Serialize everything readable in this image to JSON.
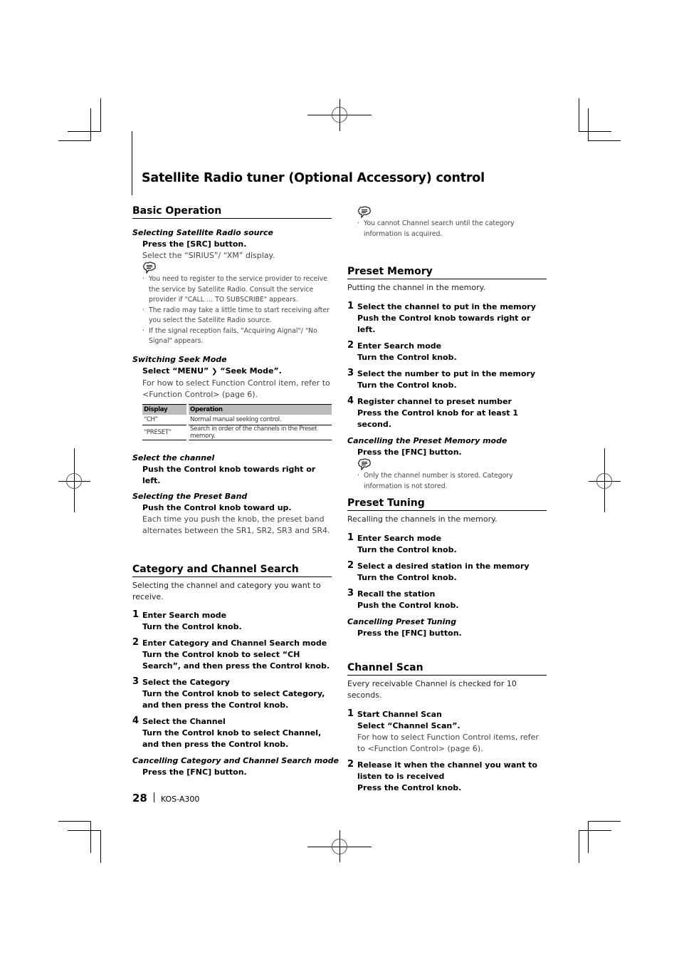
{
  "page": {
    "title": "Satellite Radio tuner (Optional Accessory) control",
    "page_number": "28",
    "model": "KOS-A300"
  },
  "basic_operation": {
    "heading": "Basic Operation",
    "source": {
      "subhead": "Selecting Satellite Radio source",
      "action": "Press the [SRC] button.",
      "detail": "Select the “SIRIUS”/ “XM” display.",
      "note_icon": "note-icon",
      "notes": [
        "You need to register to the service provider to receive the service by Satellite Radio. Consult the service provider if \"CALL … TO SUBSCRIBE\" appears.",
        "The radio may take a little time to start receiving after you select the Satellite Radio source.",
        "If the signal reception fails, \"Acquiring Aignal\"/ \"No Signal\" appears."
      ]
    },
    "seek_mode": {
      "subhead": "Switching Seek Mode",
      "action_pre": "Select “MENU”",
      "action_arrow": "❯",
      "action_post": "“Seek Mode”.",
      "detail": "For how to select Function Control item, refer to <Function Control> (page 6).",
      "table": {
        "headers": [
          "Display",
          "Operation"
        ],
        "rows": [
          [
            "“CH”",
            "Normal manual seeking control."
          ],
          [
            "“PRESET”",
            "Search in order of the channels in the Preset memory."
          ]
        ]
      }
    },
    "select_channel": {
      "subhead": "Select the channel",
      "action": "Push the Control knob towards right or left."
    },
    "preset_band": {
      "subhead": "Selecting the Preset Band",
      "action": "Push the Control knob toward up.",
      "detail": "Each time you push the knob, the preset band alternates between the SR1, SR2, SR3 and SR4."
    }
  },
  "category_search": {
    "heading": "Category and Channel Search",
    "intro": "Selecting the channel and category you want to receive.",
    "steps": [
      {
        "num": "1",
        "title": "Enter Search mode",
        "action": "Turn the Control knob."
      },
      {
        "num": "2",
        "title": "Enter Category and Channel Search mode",
        "action": "Turn the Control knob to select “CH Search”, and then press the Control knob."
      },
      {
        "num": "3",
        "title": "Select the Category",
        "action": "Turn the Control knob to select Category, and then press the Control knob."
      },
      {
        "num": "4",
        "title": "Select the Channel",
        "action": "Turn the Control knob to select Channel, and then press the Control knob."
      }
    ],
    "cancel": {
      "subhead": "Cancelling Category and Channel Search mode",
      "action": "Press the [FNC] button."
    },
    "notes": [
      "You cannot Channel search until the category information is acquired."
    ]
  },
  "preset_memory": {
    "heading": "Preset Memory",
    "intro": "Putting the channel in the memory.",
    "steps": [
      {
        "num": "1",
        "title": "Select the channel to put in the memory",
        "action": "Push the Control knob towards right or left."
      },
      {
        "num": "2",
        "title": "Enter Search mode",
        "action": "Turn the Control knob."
      },
      {
        "num": "3",
        "title": "Select the number to put in the memory",
        "action": "Turn the Control knob."
      },
      {
        "num": "4",
        "title": "Register channel to preset number",
        "action": "Press the Control knob for at least 1 second."
      }
    ],
    "cancel": {
      "subhead": "Cancelling the Preset Memory mode",
      "action": "Press the [FNC] button."
    },
    "notes": [
      "Only the channel number is stored. Category information is not stored."
    ]
  },
  "preset_tuning": {
    "heading": "Preset Tuning",
    "intro": "Recalling the channels in the memory.",
    "steps": [
      {
        "num": "1",
        "title": "Enter Search mode",
        "action": "Turn the Control knob."
      },
      {
        "num": "2",
        "title": "Select a desired station in the memory",
        "action": "Turn the Control knob."
      },
      {
        "num": "3",
        "title": "Recall the station",
        "action": "Push the Control knob."
      }
    ],
    "cancel": {
      "subhead": "Cancelling Preset Tuning",
      "action": "Press the [FNC] button."
    }
  },
  "channel_scan": {
    "heading": "Channel Scan",
    "intro": "Every receivable Channel is checked for 10 seconds.",
    "steps": [
      {
        "num": "1",
        "title": "Start Channel Scan",
        "action": "Select “Channel Scan”.",
        "note": "For how to select Function Control items, refer to <Function Control> (page 6)."
      },
      {
        "num": "2",
        "title": "Release it when the channel you want to listen to is received",
        "action": "Press the Control knob."
      }
    ]
  }
}
